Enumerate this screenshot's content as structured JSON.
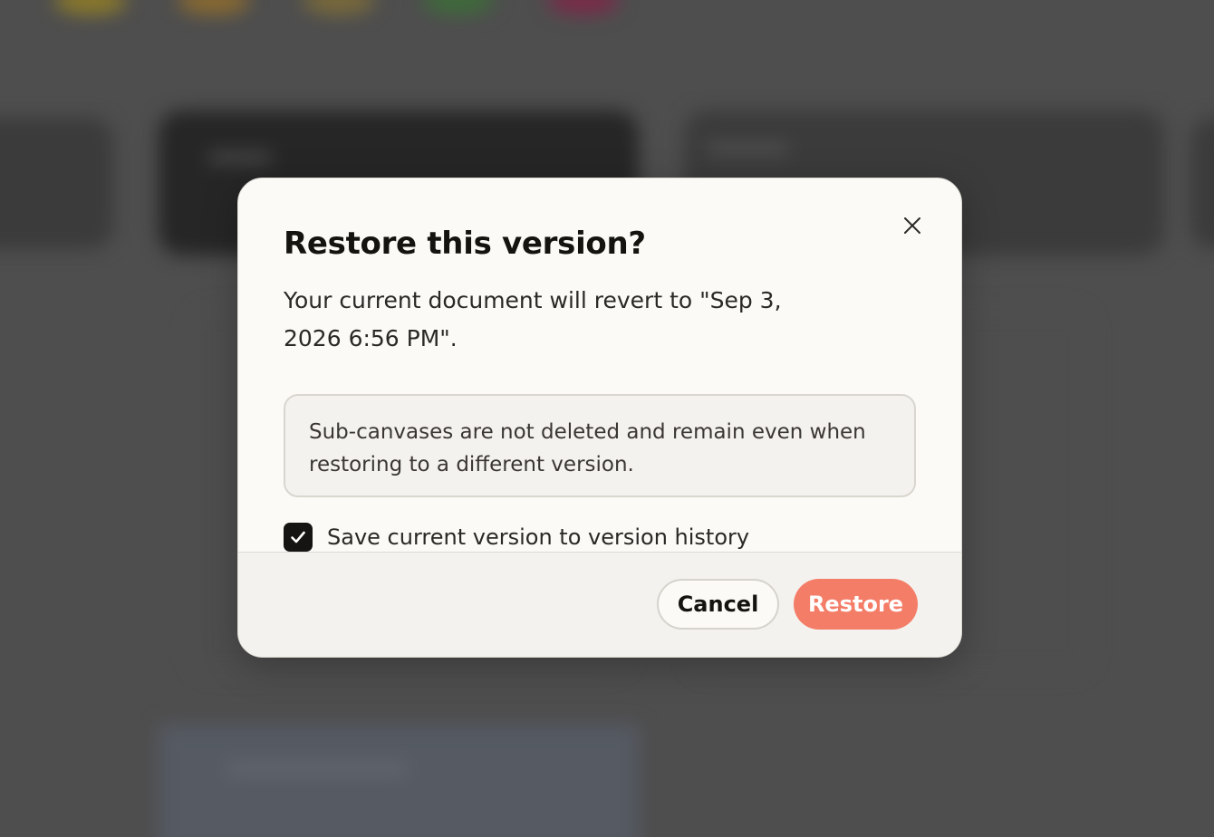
{
  "dialog": {
    "title": "Restore this version?",
    "description": "Your current document will revert to \"Sep 3, 2026 6:56 PM\".",
    "info_note": "Sub-canvases are not deleted and remain even when restoring to a different version.",
    "checkbox": {
      "label": "Save current version to version history",
      "checked": true
    },
    "buttons": {
      "cancel_label": "Cancel",
      "restore_label": "Restore"
    },
    "close_icon": "close-icon"
  },
  "colors": {
    "accent": "#f47d68",
    "overlay": "#4e4e4e",
    "dialog_bg": "#fbfaf7",
    "footer_bg": "#f4f2ee",
    "checkbox_bg": "#161412"
  }
}
